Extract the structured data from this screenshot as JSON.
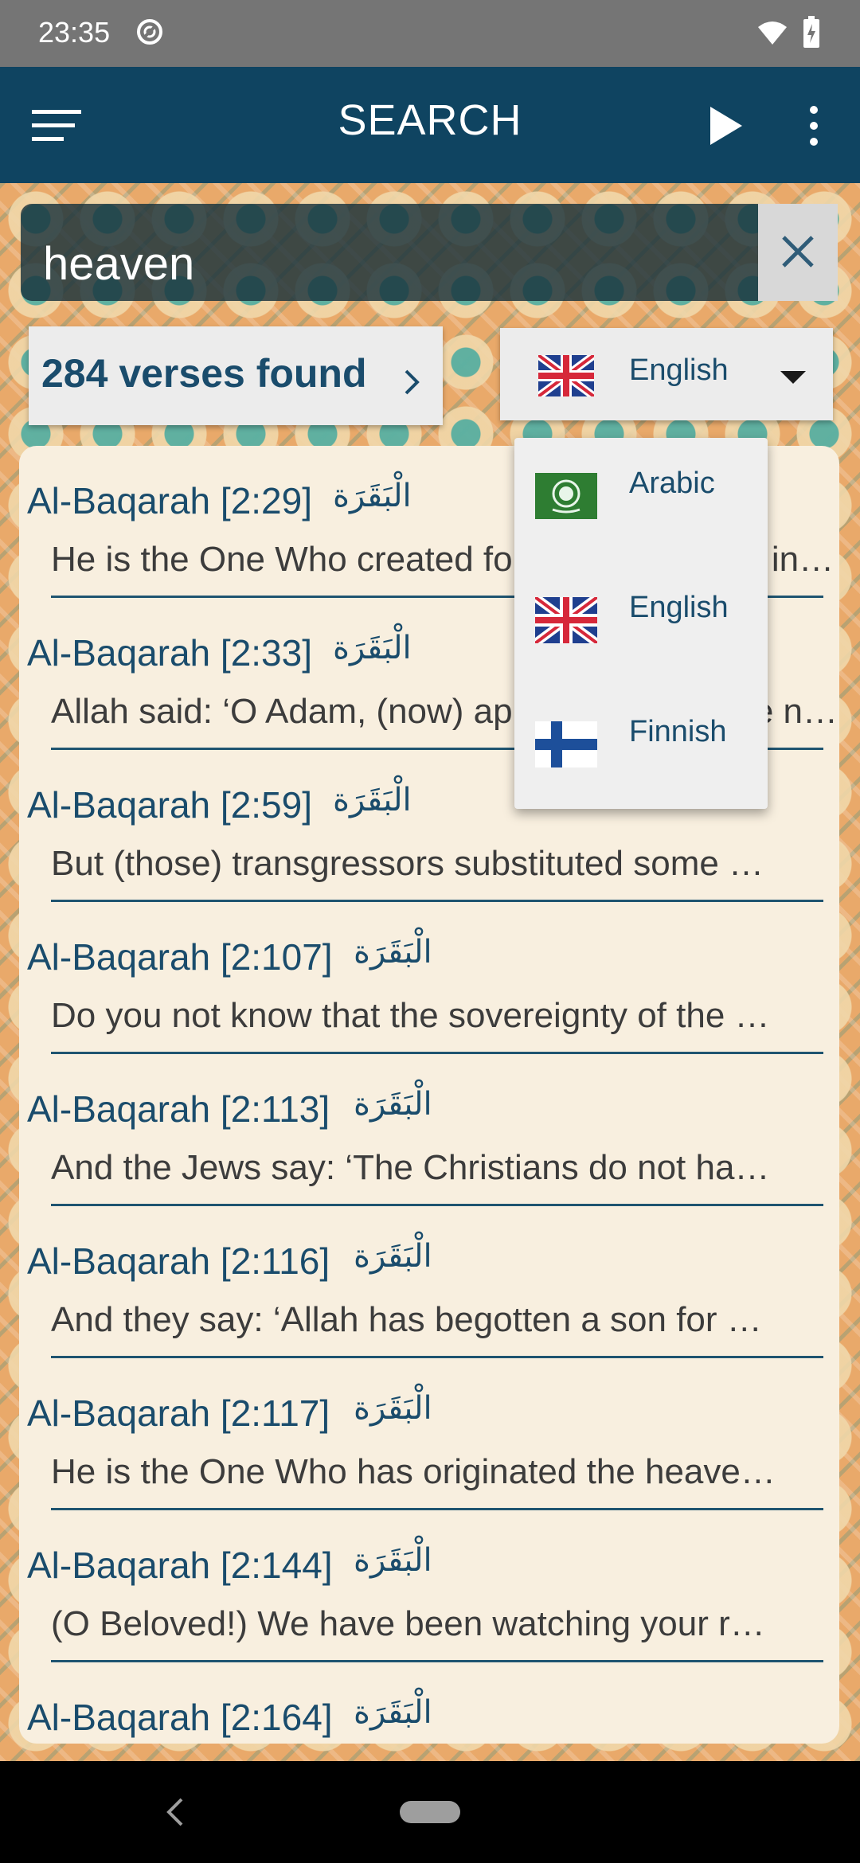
{
  "status_bar": {
    "time": "23:35"
  },
  "app_bar": {
    "title": "SEARCH"
  },
  "search": {
    "value": "heaven"
  },
  "results_summary": {
    "label": "284 verses found"
  },
  "language_select": {
    "selected": "English"
  },
  "language_dropdown": {
    "options": [
      {
        "label": "Arabic",
        "flag": "arab-league-flag"
      },
      {
        "label": "English",
        "flag": "uk-flag"
      },
      {
        "label": "Finnish",
        "flag": "finland-flag"
      }
    ]
  },
  "verses": [
    {
      "title": "Al-Baqarah [2:29]",
      "arabic": "الْبَقَرَة",
      "text": "He is the One Who created for you everything in the earth and then turned towards the heavens…"
    },
    {
      "title": "Al-Baqarah [2:33]",
      "arabic": "الْبَقَرَة",
      "text": "Allah said: ‘O Adam, (now) apprise them of the names of these things…"
    },
    {
      "title": "Al-Baqarah [2:59]",
      "arabic": "الْبَقَرَة",
      "text": "But (those) transgressors substituted some …"
    },
    {
      "title": "Al-Baqarah [2:107]",
      "arabic": "الْبَقَرَة",
      "text": "Do you not know that the sovereignty of the …"
    },
    {
      "title": "Al-Baqarah [2:113]",
      "arabic": "الْبَقَرَة",
      "text": "And the Jews say: ‘The Christians do not ha…"
    },
    {
      "title": "Al-Baqarah [2:116]",
      "arabic": "الْبَقَرَة",
      "text": "And they say: ‘Allah has begotten a son for …"
    },
    {
      "title": "Al-Baqarah [2:117]",
      "arabic": "الْبَقَرَة",
      "text": "He is the One Who has originated the heave…"
    },
    {
      "title": "Al-Baqarah [2:144]",
      "arabic": "الْبَقَرَة",
      "text": "(O Beloved!) We have been watching your r…"
    },
    {
      "title": "Al-Baqarah [2:164]",
      "arabic": "الْبَقَرَة",
      "text": ""
    }
  ],
  "colors": {
    "app_bar": "#0f4461",
    "accent_text": "#1a4c6c",
    "panel": "#f8efdf"
  }
}
